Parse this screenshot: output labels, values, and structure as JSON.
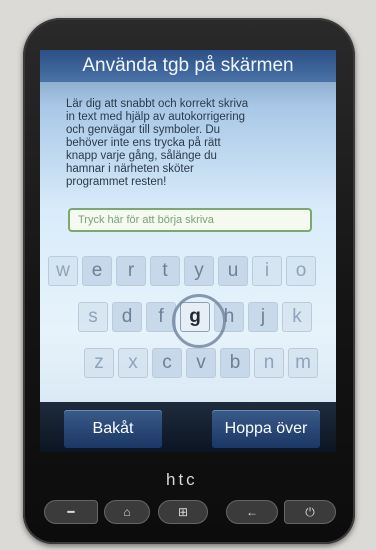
{
  "screen": {
    "title": "Använda tgb på skärmen",
    "intro": "Lär dig att snabbt och korrekt skriva\nin text med hjälp av autokorrigering\noch genvägar till symboler. Du\nbehöver inte ens trycka på rätt\nknapp varje gång, sålänge du\nhamnar i närheten sköter\nprogrammet resten!",
    "input_placeholder": "Tryck här för att börja skriva",
    "keyboard": {
      "row1": [
        "w",
        "e",
        "r",
        "t",
        "y",
        "u",
        "i",
        "o"
      ],
      "row2": [
        "s",
        "d",
        "f",
        "g",
        "h",
        "j",
        "k"
      ],
      "row3": [
        "z",
        "x",
        "c",
        "v",
        "b",
        "n",
        "m"
      ],
      "highlighted_key": "g"
    },
    "buttons": {
      "back": "Bakåt",
      "skip": "Hoppa över"
    }
  },
  "device": {
    "brand_logo": "htc"
  }
}
